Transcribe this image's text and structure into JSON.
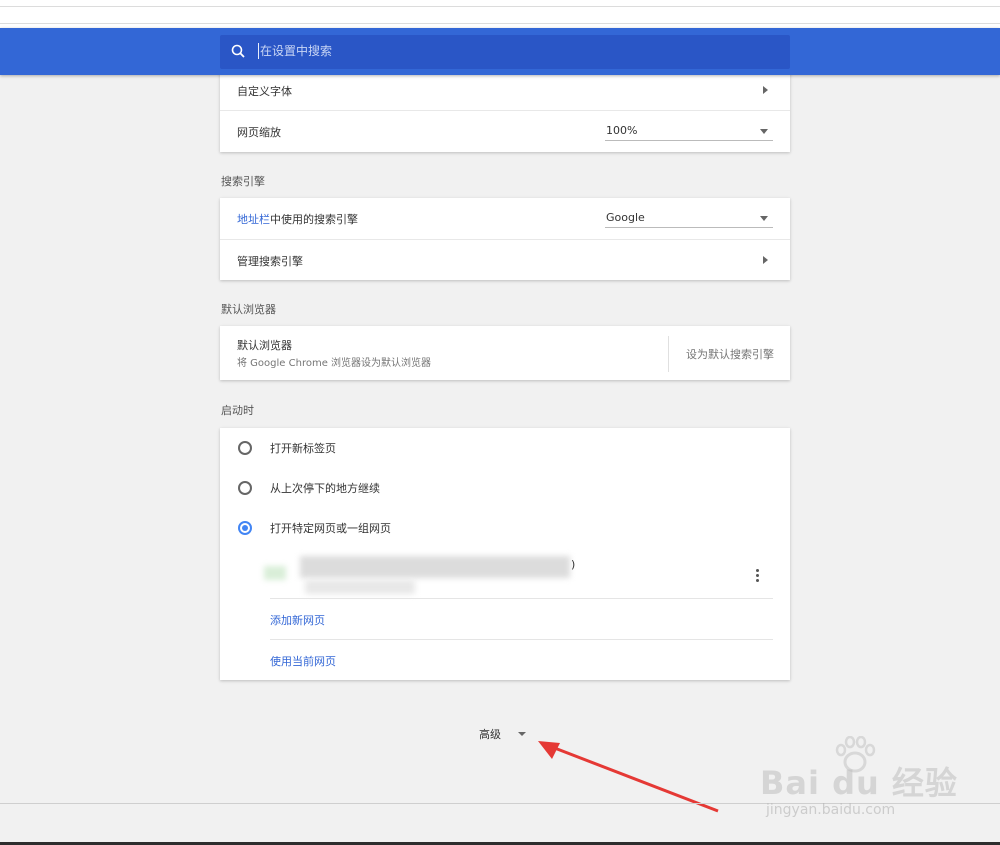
{
  "search": {
    "placeholder": "在设置中搜索",
    "icon": "search-icon"
  },
  "appearance": {
    "custom_fonts_label": "自定义字体",
    "zoom_label": "网页缩放",
    "zoom_value": "100%"
  },
  "search_engine": {
    "section_title": "搜索引擎",
    "address_bar_link": "地址栏",
    "address_bar_suffix": "中使用的搜索引擎",
    "engine_value": "Google",
    "manage_label": "管理搜索引擎"
  },
  "default_browser": {
    "section_title": "默认浏览器",
    "title": "默认浏览器",
    "subtitle": "将 Google Chrome 浏览器设为默认浏览器",
    "button_label": "设为默认搜索引擎"
  },
  "startup": {
    "section_title": "启动时",
    "options": [
      "打开新标签页",
      "从上次停下的地方继续",
      "打开特定网页或一组网页"
    ],
    "selected_index": 2,
    "page_entry_suffix": ")",
    "add_page": "添加新网页",
    "use_current": "使用当前网页"
  },
  "advanced": {
    "label": "高级"
  },
  "watermark": {
    "brand": "Bai du 经验",
    "domain": "jingyan.baidu.com"
  },
  "colors": {
    "header": "#3367d6",
    "search_box": "#2a56c6",
    "link": "#3367d6",
    "radio_selected": "#4285f4",
    "annotation_arrow": "#e53935"
  }
}
